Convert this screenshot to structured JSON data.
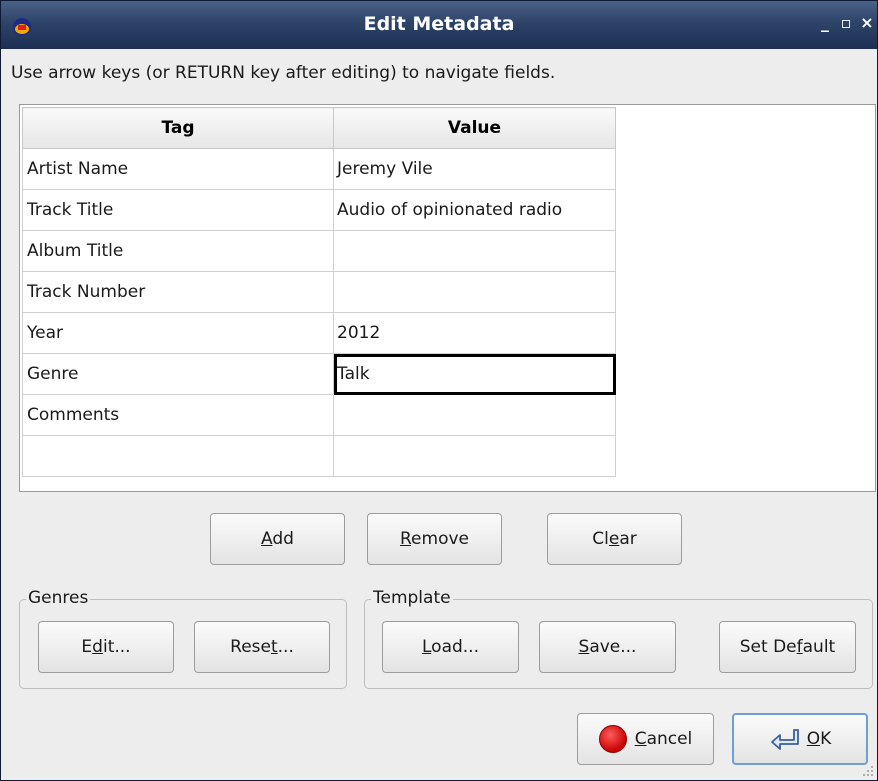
{
  "window": {
    "title": "Edit Metadata",
    "minimize": "_",
    "maximize": "▫",
    "close": "×"
  },
  "instructions": "Use arrow keys (or RETURN key after editing) to navigate fields.",
  "table": {
    "headers": {
      "tag": "Tag",
      "value": "Value"
    },
    "rows": [
      {
        "tag": "Artist Name",
        "value": "Jeremy Vile"
      },
      {
        "tag": "Track Title",
        "value": "Audio of opinionated radio"
      },
      {
        "tag": "Album Title",
        "value": ""
      },
      {
        "tag": "Track Number",
        "value": ""
      },
      {
        "tag": "Year",
        "value": "2012"
      },
      {
        "tag": "Genre",
        "value": "Talk"
      },
      {
        "tag": "Comments",
        "value": ""
      },
      {
        "tag": "",
        "value": ""
      }
    ]
  },
  "buttons": {
    "add": {
      "pre": "",
      "mn": "A",
      "post": "dd"
    },
    "remove": {
      "pre": "",
      "mn": "R",
      "post": "emove"
    },
    "clear": {
      "pre": "Cl",
      "mn": "e",
      "post": "ar"
    }
  },
  "genres": {
    "label": "Genres",
    "edit": {
      "pre": "E",
      "mn": "d",
      "post": "it..."
    },
    "reset": {
      "pre": "Rese",
      "mn": "t",
      "post": "..."
    }
  },
  "template": {
    "label": "Template",
    "load": {
      "pre": "",
      "mn": "L",
      "post": "oad..."
    },
    "save": {
      "pre": "",
      "mn": "S",
      "post": "ave..."
    },
    "set_default": {
      "pre": "Set De",
      "mn": "f",
      "post": "ault"
    }
  },
  "dialog": {
    "cancel": {
      "pre": "",
      "mn": "C",
      "post": "ancel"
    },
    "ok": {
      "pre": "",
      "mn": "O",
      "post": "K"
    }
  },
  "colors": {
    "titlebar": "#2d4468",
    "selection_border": "#000000",
    "window_bg": "#ededed"
  }
}
